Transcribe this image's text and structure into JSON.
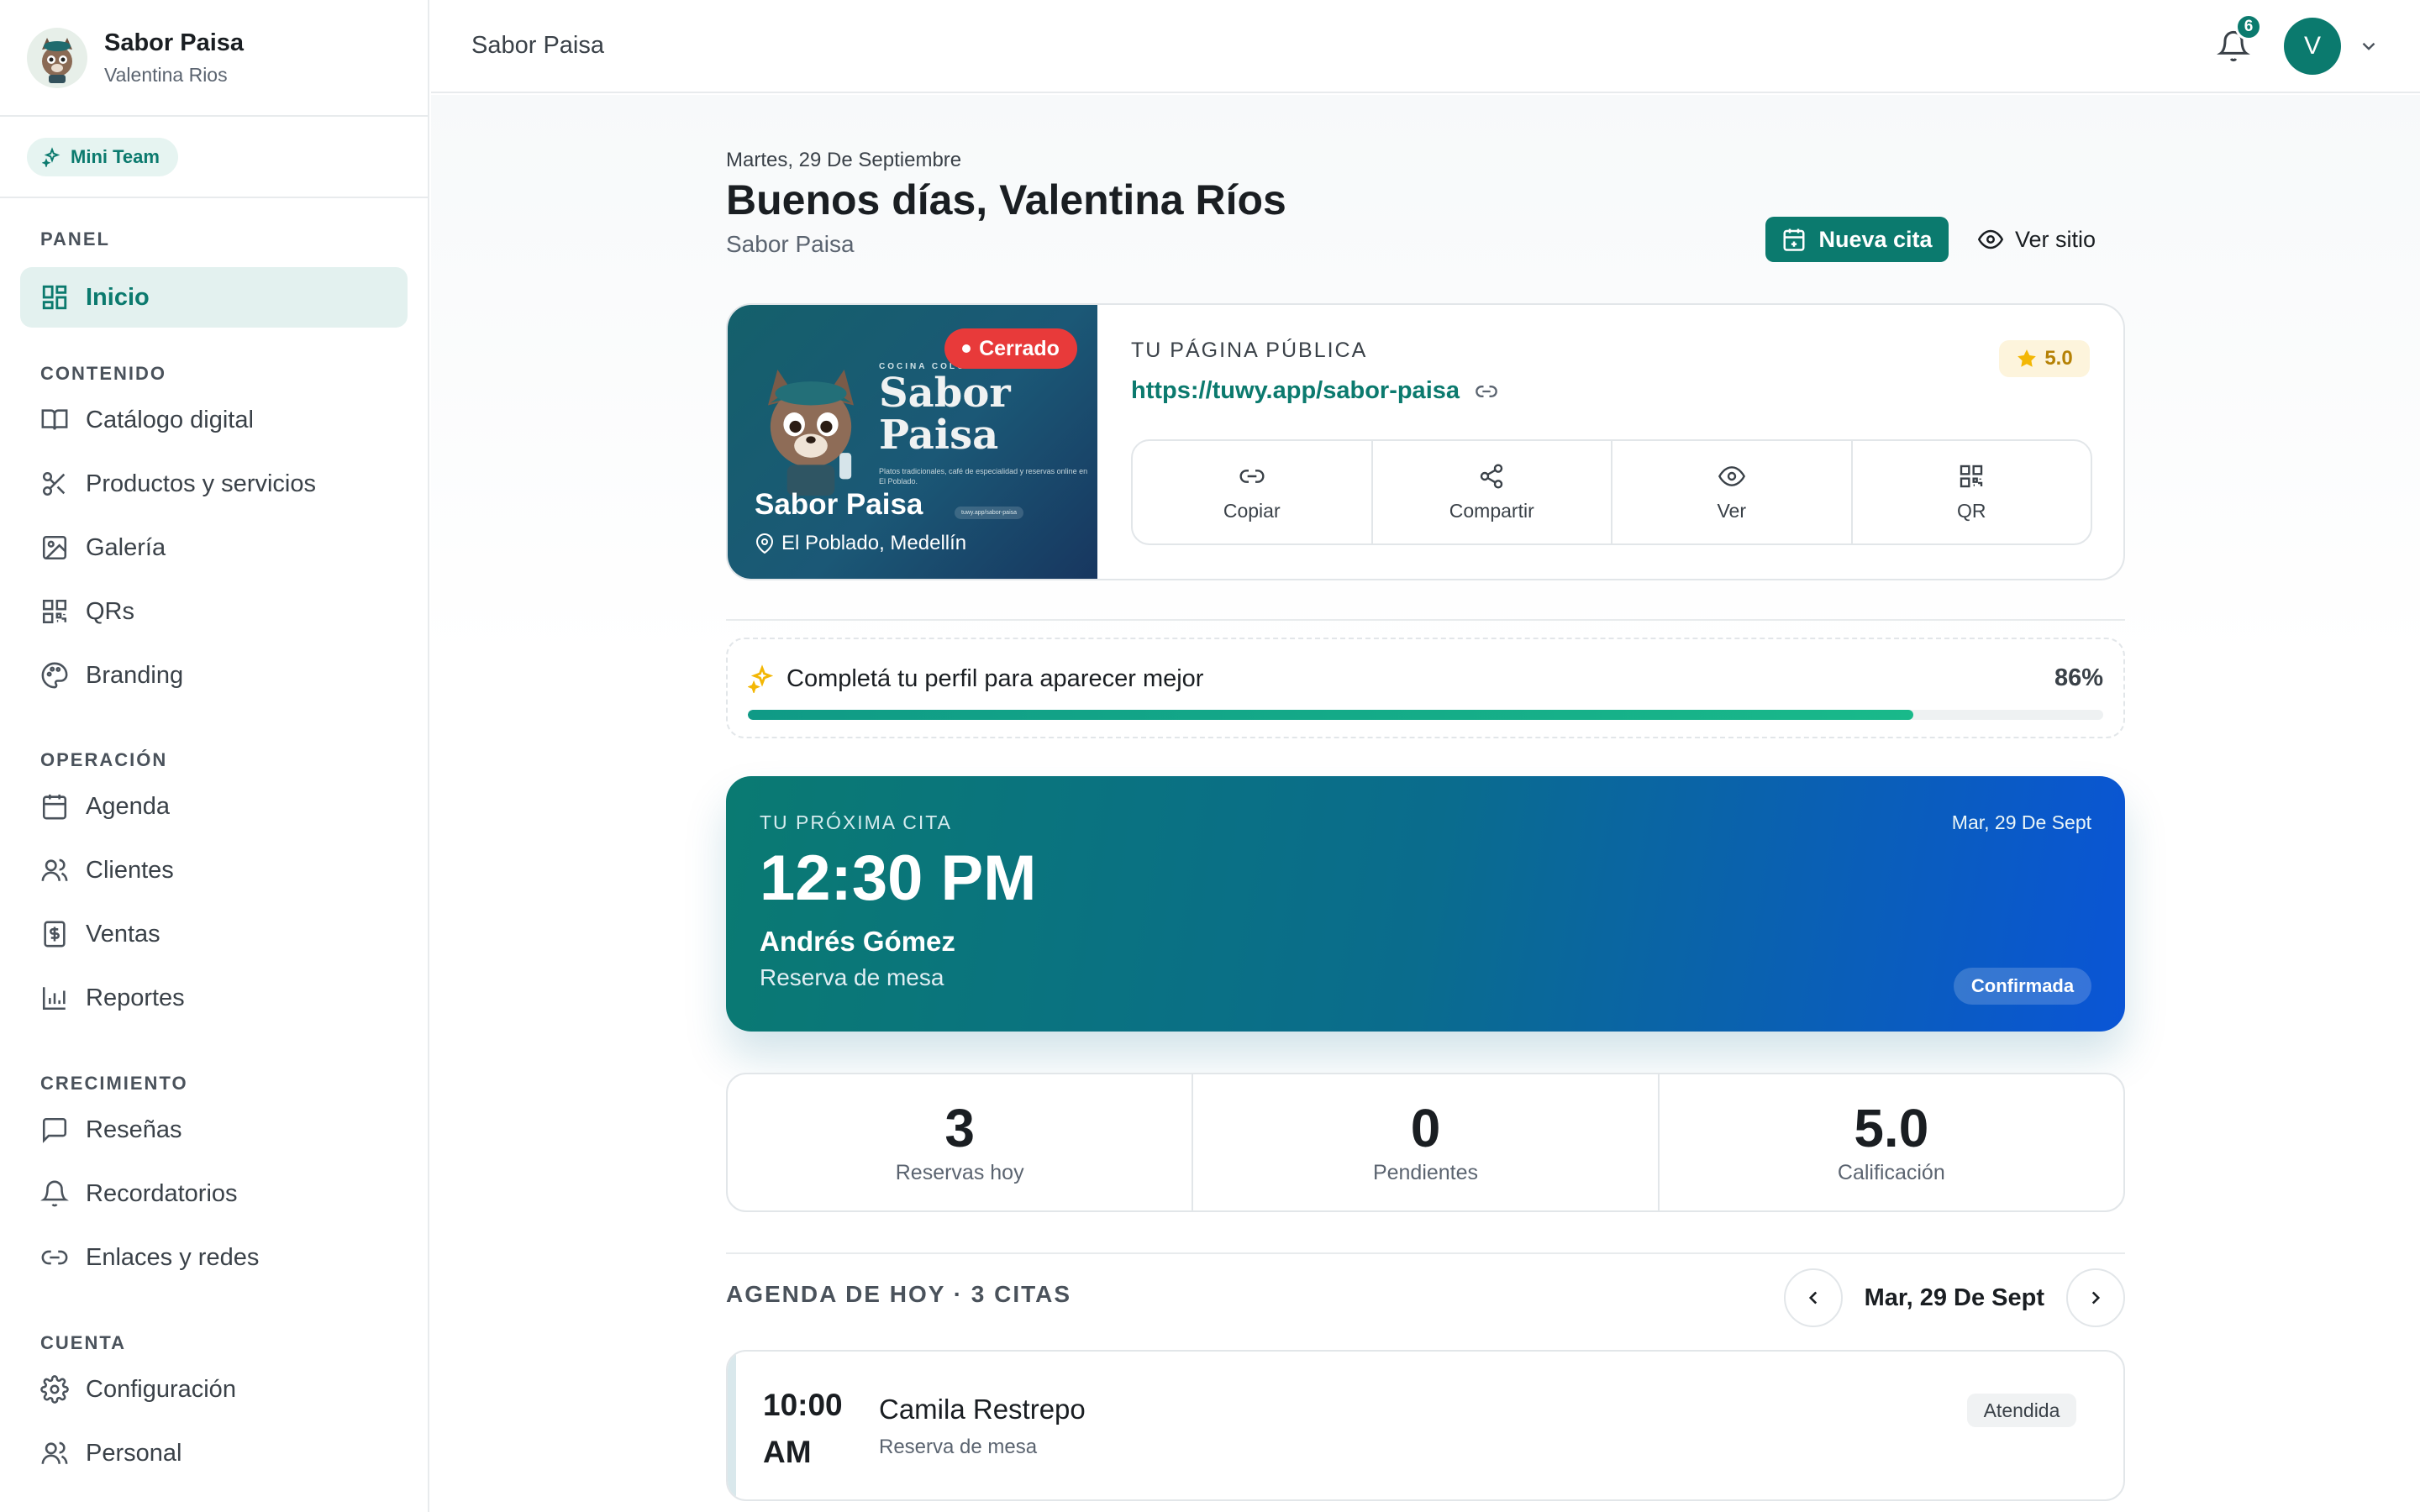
{
  "brand": {
    "name": "Sabor Paisa",
    "user": "Valentina Rios",
    "team_label": "Mini Team"
  },
  "sidebar": {
    "sections": [
      {
        "label": "PANEL",
        "items": [
          {
            "label": "Inicio",
            "icon": "grid-icon",
            "active": true
          }
        ]
      },
      {
        "label": "CONTENIDO",
        "items": [
          {
            "label": "Catálogo digital",
            "icon": "book-icon"
          },
          {
            "label": "Productos y servicios",
            "icon": "scissors-icon"
          },
          {
            "label": "Galería",
            "icon": "image-icon"
          },
          {
            "label": "QRs",
            "icon": "qr-icon"
          },
          {
            "label": "Branding",
            "icon": "palette-icon"
          }
        ]
      },
      {
        "label": "OPERACIÓN",
        "items": [
          {
            "label": "Agenda",
            "icon": "calendar-icon"
          },
          {
            "label": "Clientes",
            "icon": "users-icon"
          },
          {
            "label": "Ventas",
            "icon": "dollar-icon"
          },
          {
            "label": "Reportes",
            "icon": "bar-chart-icon"
          }
        ]
      },
      {
        "label": "CRECIMIENTO",
        "items": [
          {
            "label": "Reseñas",
            "icon": "message-icon"
          },
          {
            "label": "Recordatorios",
            "icon": "bell-icon"
          },
          {
            "label": "Enlaces y redes",
            "icon": "link-icon"
          }
        ]
      },
      {
        "label": "CUENTA",
        "items": [
          {
            "label": "Configuración",
            "icon": "gear-icon"
          },
          {
            "label": "Personal",
            "icon": "users-icon"
          }
        ]
      }
    ]
  },
  "topbar": {
    "title": "Sabor Paisa",
    "notifications": "6",
    "avatar_initial": "V"
  },
  "header": {
    "date": "Martes, 29 De Septiembre",
    "greeting": "Buenos días, Valentina Ríos",
    "business": "Sabor Paisa",
    "new_appt_label": "Nueva cita",
    "view_site_label": "Ver sitio"
  },
  "public_page": {
    "label": "TU PÁGINA PÚBLICA",
    "url": "https://tuwy.app/sabor-paisa",
    "rating": "5.0",
    "status_badge": "Cerrado",
    "cover": {
      "kicker": "COCINA COLO",
      "big_line1": "Sabor",
      "big_line2": "Paisa",
      "desc": "Platos tradicionales, café de especialidad y reservas online en El Poblado.",
      "tag": "tuwy.app/sabor-paisa",
      "name": "Sabor Paisa",
      "location": "El Poblado, Medellín"
    },
    "actions": [
      {
        "label": "Copiar",
        "icon": "link-icon"
      },
      {
        "label": "Compartir",
        "icon": "share-icon"
      },
      {
        "label": "Ver",
        "icon": "eye-icon"
      },
      {
        "label": "QR",
        "icon": "qr-icon"
      }
    ]
  },
  "profile_progress": {
    "title": "Completá tu perfil para aparecer mejor",
    "percent_label": "86%",
    "percent": 86
  },
  "next_appt": {
    "label": "TU PRÓXIMA CITA",
    "date": "Mar, 29 De Sept",
    "time": "12:30 PM",
    "client": "Andrés Gómez",
    "service": "Reserva de mesa",
    "status": "Confirmada"
  },
  "stats": [
    {
      "value": "3",
      "label": "Reservas hoy"
    },
    {
      "value": "0",
      "label": "Pendientes"
    },
    {
      "value": "5.0",
      "label": "Calificación"
    }
  ],
  "agenda": {
    "heading": "AGENDA DE HOY · 3 CITAS",
    "date": "Mar, 29 De Sept",
    "items": [
      {
        "time": "10:00 AM",
        "client": "Camila Restrepo",
        "service": "Reserva de mesa",
        "status": "Atendida"
      }
    ]
  },
  "colors": {
    "accent": "#0b7a6e",
    "danger": "#e83a3a",
    "star": "#f3b705",
    "progress": "#19b98a"
  }
}
